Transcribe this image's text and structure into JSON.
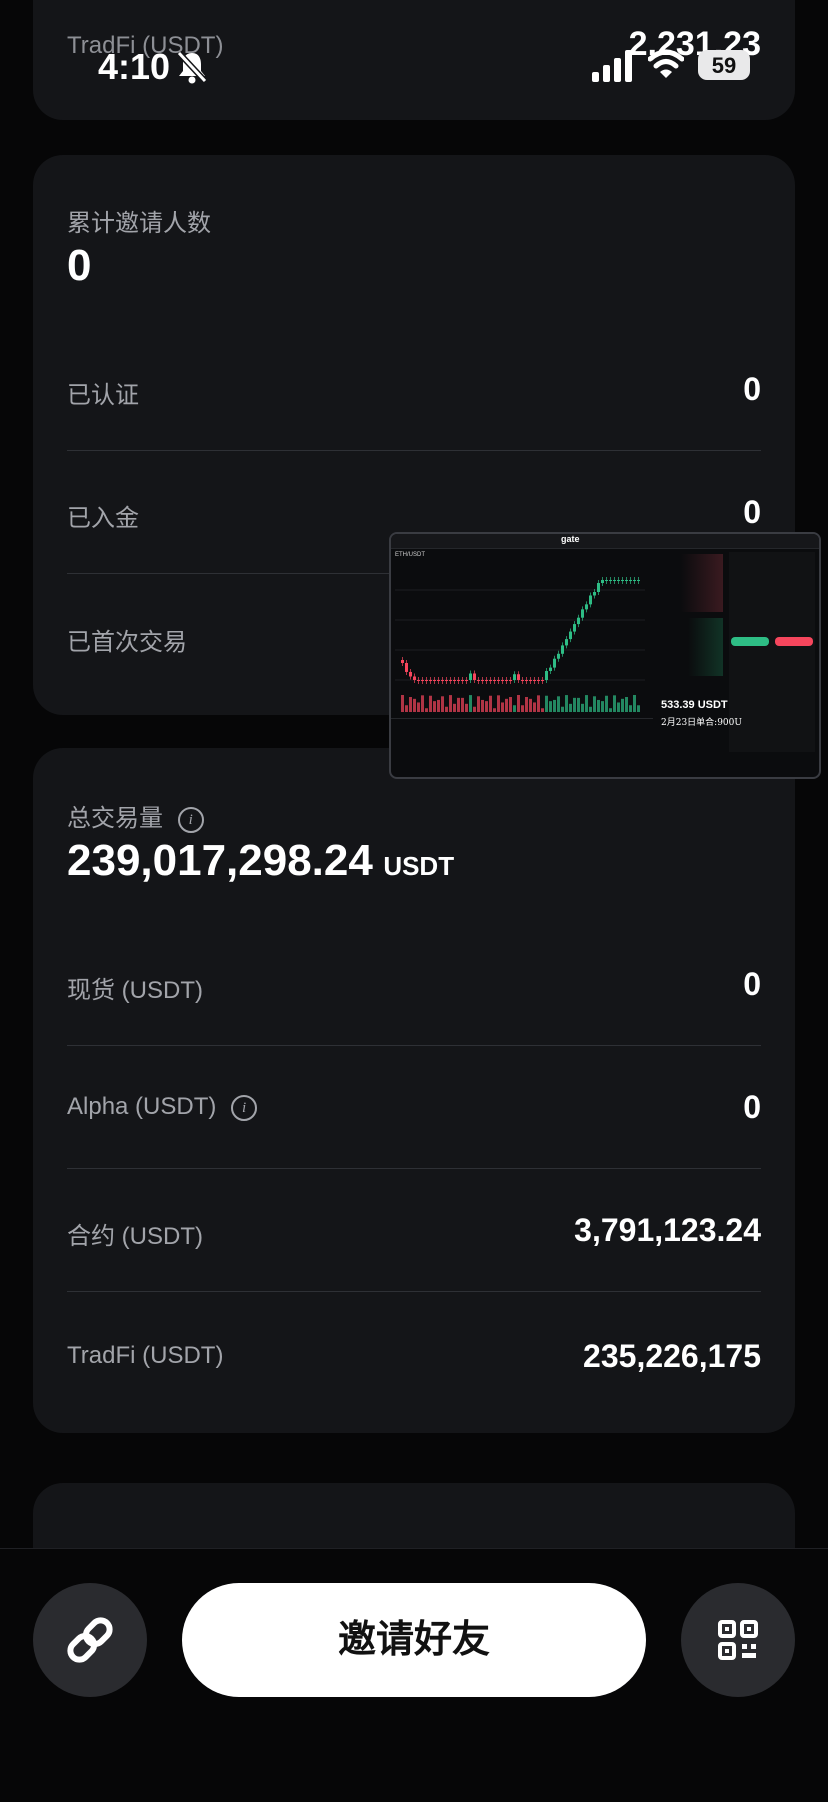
{
  "status_bar": {
    "time": "4:10",
    "battery": "59"
  },
  "top_card": {
    "label": "TradFi (USDT)",
    "value": "2,231.23"
  },
  "invites": {
    "total_label": "累计邀请人数",
    "total_value": "0",
    "rows": [
      {
        "label": "已认证",
        "value": "0"
      },
      {
        "label": "已入金",
        "value": "0"
      },
      {
        "label": "已首次交易",
        "value": ""
      }
    ]
  },
  "volume": {
    "title": "总交易量",
    "total": "239,017,298.24",
    "unit": "USDT",
    "rows": [
      {
        "label": "现货 (USDT)",
        "value": "0"
      },
      {
        "label": "Alpha (USDT)",
        "value": "0"
      },
      {
        "label": "合约 (USDT)",
        "value": "3,791,123.24"
      },
      {
        "label": "TradFi (USDT)",
        "value": "235,226,175"
      }
    ]
  },
  "pip_overlay": {
    "brand": "gate",
    "pair": "ETH/USDT",
    "price_label": "533.39 USDT",
    "caption": "2月23日单合:900U"
  },
  "bottom": {
    "invite_label": "邀请好友"
  },
  "icons": {
    "link": "link-icon",
    "qr": "qr-code-icon",
    "mute": "bell-slash-icon",
    "signal": "signal-icon",
    "wifi": "wifi-icon",
    "battery": "battery-icon"
  },
  "colors": {
    "background": "#060607",
    "card": "#141518",
    "up": "#2ebd85",
    "down": "#f6465d"
  }
}
